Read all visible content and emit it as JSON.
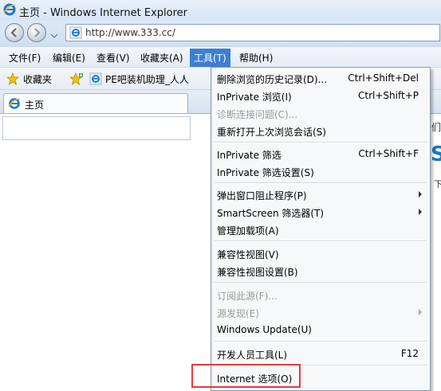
{
  "window": {
    "title": "主页 - Windows Internet Explorer"
  },
  "address_bar": {
    "url": "http://www.333.cc/"
  },
  "menubar": {
    "items": [
      "文件(F)",
      "编辑(E)",
      "查看(V)",
      "收藏夹(A)",
      "工具(T)",
      "帮助(H)"
    ],
    "active": "工具(T)"
  },
  "favorites_bar": {
    "label": "收藏夹",
    "link": "PE吧装机助理_人人"
  },
  "tab": {
    "label": "主页"
  },
  "tools_menu": {
    "items": [
      {
        "label": "删除浏览的历史记录(D)...",
        "shortcut": "Ctrl+Shift+Del",
        "disabled": false,
        "submenu": false
      },
      {
        "label": "InPrivate 浏览(I)",
        "shortcut": "Ctrl+Shift+P",
        "disabled": false,
        "submenu": false
      },
      {
        "label": "诊断连接问题(C)...",
        "shortcut": "",
        "disabled": true,
        "submenu": false
      },
      {
        "label": "重新打开上次浏览会话(S)",
        "shortcut": "",
        "disabled": false,
        "submenu": false
      },
      {
        "label": "InPrivate 筛选",
        "shortcut": "Ctrl+Shift+F",
        "disabled": false,
        "submenu": false
      },
      {
        "label": "InPrivate 筛选设置(S)",
        "shortcut": "",
        "disabled": false,
        "submenu": false
      },
      {
        "label": "弹出窗口阻止程序(P)",
        "shortcut": "",
        "disabled": false,
        "submenu": true
      },
      {
        "label": "SmartScreen 筛选器(T)",
        "shortcut": "",
        "disabled": false,
        "submenu": true
      },
      {
        "label": "管理加载项(A)",
        "shortcut": "",
        "disabled": false,
        "submenu": false
      },
      {
        "label": "兼容性视图(V)",
        "shortcut": "",
        "disabled": false,
        "submenu": false
      },
      {
        "label": "兼容性视图设置(B)",
        "shortcut": "",
        "disabled": false,
        "submenu": false
      },
      {
        "label": "订阅此源(F)...",
        "shortcut": "",
        "disabled": true,
        "submenu": false
      },
      {
        "label": "源发现(E)",
        "shortcut": "",
        "disabled": true,
        "submenu": true
      },
      {
        "label": "Windows Update(U)",
        "shortcut": "",
        "disabled": false,
        "submenu": false
      },
      {
        "label": "开发人员工具(L)",
        "shortcut": "F12",
        "disabled": false,
        "submenu": false
      },
      {
        "label": "Internet 选项(O)",
        "shortcut": "",
        "disabled": false,
        "submenu": false
      }
    ],
    "highlighted": "Internet 选项(O)"
  },
  "page_peek": {
    "glyphs": [
      "们",
      "S",
      "下"
    ]
  },
  "colors": {
    "menu_active": "#3d7fd3",
    "highlight_box": "#e03c3c",
    "ie_blue": "#1a79c9"
  }
}
